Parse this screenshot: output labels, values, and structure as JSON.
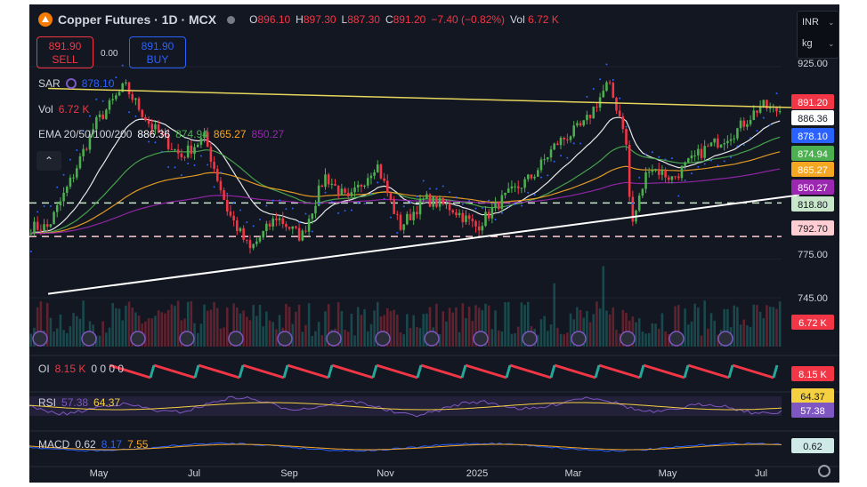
{
  "header": {
    "title": "Copper Futures · 1D · MCX",
    "open_label": "O",
    "open": "896.10",
    "high_label": "H",
    "high": "897.30",
    "low_label": "L",
    "low": "887.30",
    "close_label": "C",
    "close": "891.20",
    "change": "−7.40 (−0.82%)",
    "vol_label": "Vol",
    "vol": "6.72 K"
  },
  "trade": {
    "sell_price": "891.90",
    "sell_label": "SELL",
    "spread": "0.00",
    "buy_price": "891.90",
    "buy_label": "BUY"
  },
  "units": {
    "currency": "INR",
    "unit": "kg"
  },
  "indicators": {
    "sar_label": "SAR",
    "sar_value": "878.10",
    "vol_label": "Vol",
    "vol_value": "6.72 K",
    "ema_label": "EMA 20/50/100/200",
    "ema_values": [
      "886.36",
      "874.94",
      "865.27",
      "850.27"
    ],
    "oi_label": "OI",
    "oi_value": "8.15 K",
    "oi_zeros": "0 0 0 0",
    "rsi_label": "RSI",
    "rsi_value": "57.38",
    "rsi_ma": "64.37",
    "macd_label": "MACD",
    "macd_values": [
      "0.62",
      "8.17",
      "7.55"
    ]
  },
  "colors": {
    "bg": "#131722",
    "up": "#26a69a",
    "up_candle": "#4caf50",
    "down": "#f23645",
    "ema20": "#ffffff",
    "ema50": "#4caf50",
    "ema100": "#f5a623",
    "ema200": "#9c27b0",
    "sar": "#2962ff",
    "resistance": "#e6d65c",
    "support": "#ffffff",
    "rsi": "#7e57c2",
    "rsi_ma": "#f5d142"
  },
  "chart_data": {
    "type": "candlestick",
    "symbol": "Copper Futures",
    "interval": "1D",
    "exchange": "MCX",
    "ylim": [
      745,
      925
    ],
    "y_ticks": [
      925.0,
      775.0,
      745.0
    ],
    "x_ticks": [
      "May",
      "Jul",
      "Sep",
      "Nov",
      "2025",
      "Mar",
      "May",
      "Jul"
    ],
    "horizontal_levels": [
      818.8,
      792.7
    ],
    "price_labels": [
      {
        "value": "891.20",
        "color": "#f23645"
      },
      {
        "value": "886.36",
        "color": "#ffffff"
      },
      {
        "value": "878.10",
        "color": "#2962ff"
      },
      {
        "value": "874.94",
        "color": "#4caf50"
      },
      {
        "value": "865.27",
        "color": "#f5a623"
      },
      {
        "value": "850.27",
        "color": "#9c27b0"
      },
      {
        "value": "818.80",
        "color": "#c8e6c9"
      },
      {
        "value": "792.70",
        "color": "#ffcdd2"
      },
      {
        "value": "6.72 K",
        "color": "#f23645"
      }
    ],
    "trendlines": [
      {
        "name": "resistance",
        "from": {
          "x": "2024-04",
          "y": 908
        },
        "to": {
          "x": "2025-07",
          "y": 893
        }
      },
      {
        "name": "support",
        "from": {
          "x": "2024-04",
          "y": 748
        },
        "to": {
          "x": "2025-07",
          "y": 825
        }
      }
    ],
    "close_path": [
      {
        "x": "2024-04-01",
        "y": 800
      },
      {
        "x": "2024-04-15",
        "y": 835
      },
      {
        "x": "2024-05-01",
        "y": 880
      },
      {
        "x": "2024-05-20",
        "y": 910
      },
      {
        "x": "2024-06-05",
        "y": 880
      },
      {
        "x": "2024-06-25",
        "y": 855
      },
      {
        "x": "2024-07-10",
        "y": 870
      },
      {
        "x": "2024-07-25",
        "y": 812
      },
      {
        "x": "2024-08-08",
        "y": 782
      },
      {
        "x": "2024-08-25",
        "y": 808
      },
      {
        "x": "2024-09-10",
        "y": 792
      },
      {
        "x": "2024-09-25",
        "y": 840
      },
      {
        "x": "2024-10-10",
        "y": 820
      },
      {
        "x": "2024-10-28",
        "y": 850
      },
      {
        "x": "2024-11-12",
        "y": 800
      },
      {
        "x": "2024-11-28",
        "y": 822
      },
      {
        "x": "2024-12-15",
        "y": 815
      },
      {
        "x": "2024-12-31",
        "y": 800
      },
      {
        "x": "2025-01-15",
        "y": 820
      },
      {
        "x": "2025-02-05",
        "y": 840
      },
      {
        "x": "2025-02-20",
        "y": 865
      },
      {
        "x": "2025-03-10",
        "y": 880
      },
      {
        "x": "2025-03-25",
        "y": 912
      },
      {
        "x": "2025-04-05",
        "y": 875
      },
      {
        "x": "2025-04-09",
        "y": 800
      },
      {
        "x": "2025-04-20",
        "y": 848
      },
      {
        "x": "2025-05-05",
        "y": 838
      },
      {
        "x": "2025-05-25",
        "y": 860
      },
      {
        "x": "2025-06-15",
        "y": 875
      },
      {
        "x": "2025-07-01",
        "y": 895
      },
      {
        "x": "2025-07-08",
        "y": 891.2
      }
    ]
  }
}
